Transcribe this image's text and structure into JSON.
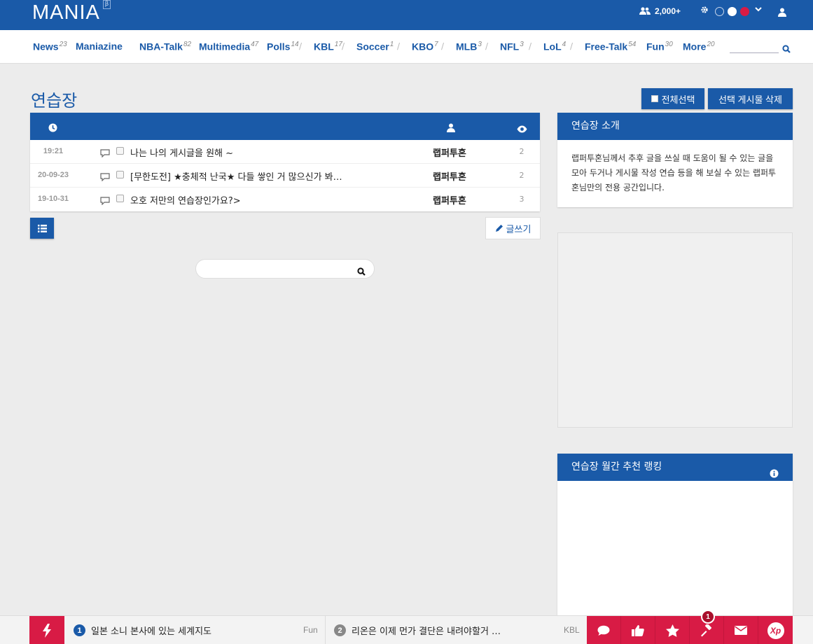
{
  "header": {
    "logo": "MANIA",
    "logo_badge": "β",
    "users_count": "2,000+",
    "colors": {
      "primary": "#1a5aa8",
      "accent": "#d81b45"
    }
  },
  "nav": {
    "items": [
      {
        "label": "News",
        "count": "23"
      },
      {
        "label": "Maniazine",
        "count": ""
      },
      {
        "label": "NBA-Talk",
        "count": "82"
      },
      {
        "label": "Multimedia",
        "count": "47"
      },
      {
        "label": "Polls",
        "count": "14"
      },
      {
        "label": "KBL",
        "count": "17"
      },
      {
        "label": "Soccer",
        "count": "1"
      },
      {
        "label": "KBO",
        "count": "7"
      },
      {
        "label": "MLB",
        "count": "3"
      },
      {
        "label": "NFL",
        "count": "3"
      },
      {
        "label": "LoL",
        "count": "4"
      },
      {
        "label": "Free-Talk",
        "count": "54"
      },
      {
        "label": "Fun",
        "count": "30"
      },
      {
        "label": "More",
        "count": "20"
      }
    ],
    "separator": "/"
  },
  "page": {
    "title": "연습장",
    "select_all_label": "전체선택",
    "delete_selected_label": "선택 게시물 삭제",
    "write_label": "글쓰기"
  },
  "board": {
    "columns": [
      "clock-icon",
      "user-icon",
      "eye-icon"
    ],
    "rows": [
      {
        "date": "19:21",
        "title": "나는 나의 게시글을 원해 ~",
        "author": "랩퍼투혼",
        "views": "2"
      },
      {
        "date": "20-09-23",
        "title": "[무한도전] ★충체적 난국★ 다들 쌓인 거 많으신가 봐…",
        "author": "랩퍼투혼",
        "views": "2"
      },
      {
        "date": "19-10-31",
        "title": "오호 저만의 연습장인가요?>",
        "author": "랩퍼투혼",
        "views": "3"
      }
    ]
  },
  "sidebar": {
    "intro_title": "연습장 소개",
    "intro_text": "랩퍼투혼님께서 추후 글을 쓰실 때 도움이 될 수 있는 글을 모아 두거나 게시물 작성 연습 등을 해 보실 수 있는 랩퍼투혼님만의 전용 공간입니다.",
    "ranking_title": "연습장 월간 추천 랭킹"
  },
  "bottom": {
    "tickers": [
      {
        "num": "1",
        "text": "일본 소니 본사에 있는 세계지도",
        "category": "Fun",
        "color": "#1a5aa8"
      },
      {
        "num": "2",
        "text": "리온은 이제 먼가 결단은 내려야할거 …",
        "category": "KBL",
        "color": "#888888"
      }
    ],
    "actions": [
      "comment-icon",
      "thumbs-up-icon",
      "star-icon",
      "gavel-icon",
      "envelope-icon",
      "xp-icon"
    ],
    "badge_count": "1",
    "xp_label": "Xp"
  }
}
